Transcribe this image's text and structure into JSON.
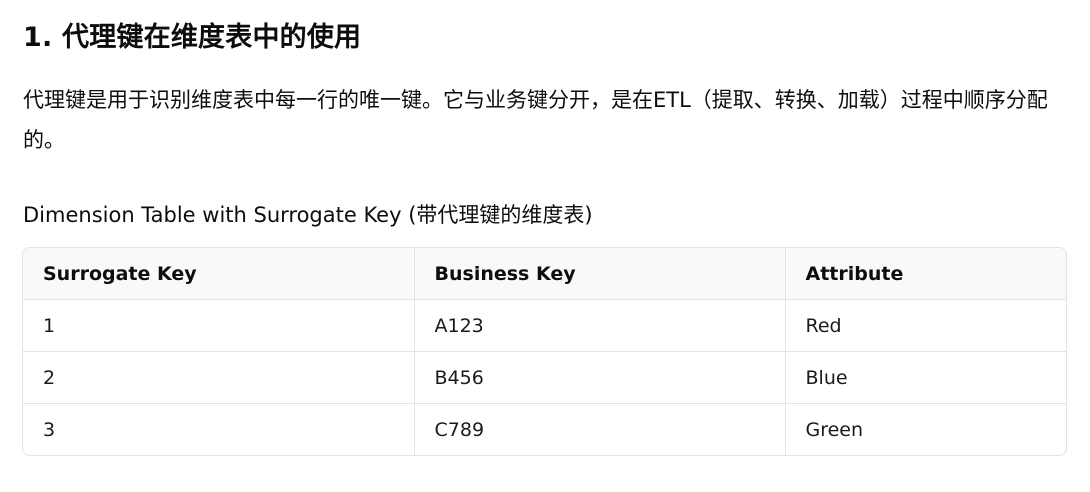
{
  "heading": "1. 代理键在维度表中的使用",
  "paragraph": "代理键是用于识别维度表中每一行的唯一键。它与业务键分开，是在ETL（提取、转换、加载）过程中顺序分配的。",
  "caption": "Dimension Table with Surrogate Key (带代理键的维度表)",
  "table": {
    "headers": [
      "Surrogate Key",
      "Business Key",
      "Attribute"
    ],
    "rows": [
      [
        "1",
        "A123",
        "Red"
      ],
      [
        "2",
        "B456",
        "Blue"
      ],
      [
        "3",
        "C789",
        "Green"
      ]
    ]
  }
}
